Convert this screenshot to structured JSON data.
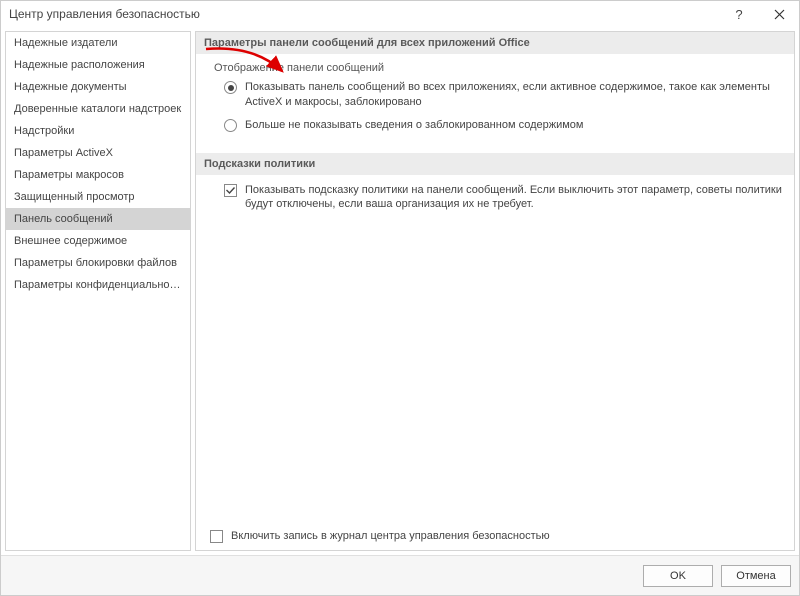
{
  "title": "Центр управления безопасностью",
  "sidebar": {
    "items": [
      {
        "label": "Надежные издатели"
      },
      {
        "label": "Надежные расположения"
      },
      {
        "label": "Надежные документы"
      },
      {
        "label": "Доверенные каталоги надстроек"
      },
      {
        "label": "Надстройки"
      },
      {
        "label": "Параметры ActiveX"
      },
      {
        "label": "Параметры макросов"
      },
      {
        "label": "Защищенный просмотр"
      },
      {
        "label": "Панель сообщений",
        "selected": true
      },
      {
        "label": "Внешнее содержимое"
      },
      {
        "label": "Параметры блокировки файлов"
      },
      {
        "label": "Параметры конфиденциальности"
      }
    ]
  },
  "section1": {
    "header": "Параметры панели сообщений для всех приложений Office",
    "subhead": "Отображение панели сообщений",
    "radio1": "Показывать панель сообщений во всех приложениях, если активное содержимое, такое как элементы ActiveX и макросы, заблокировано",
    "radio2": "Больше не показывать сведения о заблокированном содержимом"
  },
  "section2": {
    "header": "Подсказки политики",
    "check1": "Показывать подсказку политики на панели сообщений. Если выключить этот параметр, советы политики будут отключены, если ваша организация их не требует."
  },
  "bottom_check": "Включить запись в журнал центра управления безопасностью",
  "buttons": {
    "ok": "OK",
    "cancel": "Отмена"
  }
}
